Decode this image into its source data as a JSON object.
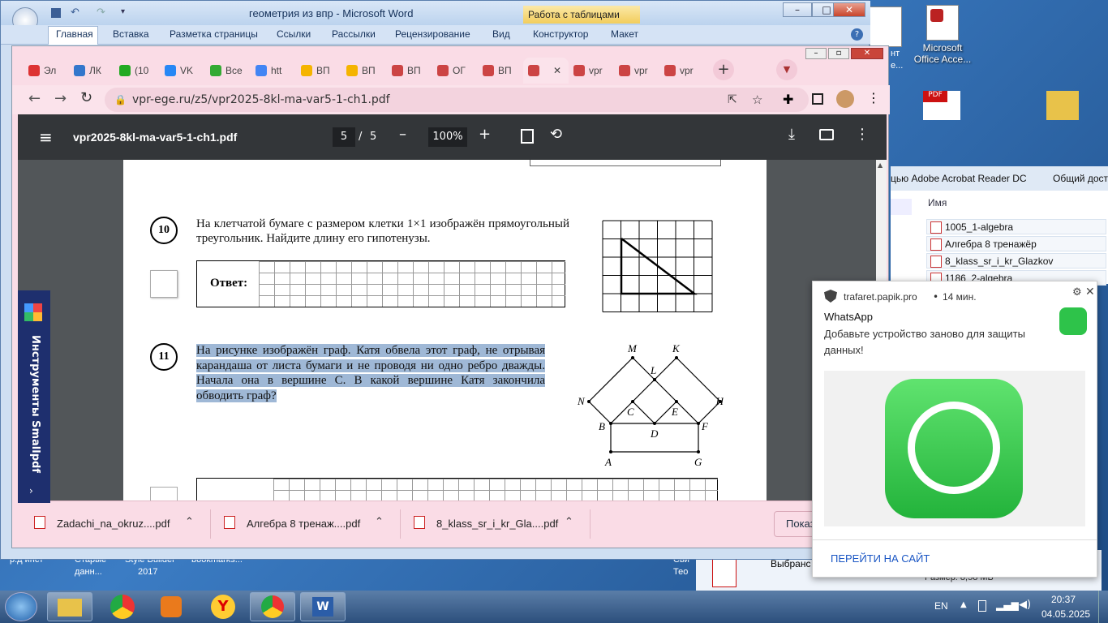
{
  "word": {
    "title": "геометрия из впр - Microsoft Word",
    "table_tools": "Работа с таблицами",
    "tabs": [
      "Главная",
      "Вставка",
      "Разметка страницы",
      "Ссылки",
      "Рассылки",
      "Рецензирование",
      "Вид",
      "Конструктор",
      "Макет"
    ]
  },
  "desktop": {
    "icons": [
      {
        "label": "Microsoft Office Acce..."
      }
    ],
    "partial_texts": [
      "нт",
      "е...",
      "р.д инст",
      "Старые",
      "данн...",
      "Style Builder",
      "2017",
      "bookmarks...",
      "Сви",
      "Тео",
      "Выбранс"
    ]
  },
  "chrome": {
    "tabs": [
      {
        "label": "Эл",
        "color": "#d33"
      },
      {
        "label": "ЛК",
        "color": "#3377cc"
      },
      {
        "label": "(10",
        "color": "#2a2"
      },
      {
        "label": "VK",
        "color": "#2787f5"
      },
      {
        "label": "Все",
        "color": "#3a3"
      },
      {
        "label": "htt",
        "color": "#4285f4"
      },
      {
        "label": "ВП",
        "color": "#f5b400"
      },
      {
        "label": "ВП",
        "color": "#f5b400"
      },
      {
        "label": "ВП",
        "color": "#c44"
      },
      {
        "label": "ОГ",
        "color": "#c44"
      },
      {
        "label": "ВП",
        "color": "#c44"
      },
      {
        "label": "",
        "color": "#c44"
      },
      {
        "label": "vpr",
        "color": "#c44"
      },
      {
        "label": "vpr",
        "color": "#c44"
      },
      {
        "label": "vpr",
        "color": "#c44"
      }
    ],
    "active_tab_index": 11,
    "url": "vpr-ege.ru/z5/vpr2025-8kl-ma-var5-1-ch1.pdf"
  },
  "pdf": {
    "filename": "vpr2025-8kl-ma-var5-1-ch1.pdf",
    "page_current": "5",
    "page_sep": "/",
    "page_total": "5",
    "zoom": "100%"
  },
  "task10": {
    "num": "10",
    "text": "На клетчатой бумаге с размером клетки 1×1 изображён прямоугольный треугольник. Найдите длину его гипотенузы.",
    "answer_label": "Ответ:"
  },
  "task11": {
    "num": "11",
    "text": "На рисунке изображён граф. Катя обвела этот граф, не отрывая карандаша от листа бумаги и не проводя ни одно ребро дважды. Начала она в вершине C. В какой вершине Катя закончила обводить граф?",
    "vertices": {
      "M": "M",
      "K": "K",
      "L": "L",
      "N": "N",
      "H": "H",
      "C": "C",
      "E": "E",
      "B": "B",
      "D": "D",
      "F": "F",
      "A": "A",
      "G": "G"
    }
  },
  "downloads": [
    {
      "name": "Zadachi_na_okruz....pdf"
    },
    {
      "name": "Алгебра 8 тренаж....pdf"
    },
    {
      "name": "8_klass_sr_i_kr_Gla....pdf"
    }
  ],
  "downloads_show": "Показ",
  "smallpdf": {
    "label": "Инструменты Smallpdf"
  },
  "explorer": {
    "open_with": "цью Adobe Acrobat Reader DC",
    "share": "Общий дост",
    "col_name": "Имя",
    "files": [
      "1005_1-algebra",
      "Алгебра 8 тренажёр",
      "8_klass_sr_i_kr_Glazkov",
      "1186_2-algebra"
    ],
    "size_label": "Размер: 8,58 МБ"
  },
  "notification": {
    "site": "trafaret.papik.pro",
    "time": "14 мин.",
    "app": "WhatsApp",
    "message": "Добавьте устройство заново для защиты данных!",
    "action": "ПЕРЕЙТИ НА САЙТ",
    "dot": "•"
  },
  "taskbar": {
    "lang": "EN",
    "time": "20:37",
    "date": "04.05.2025"
  }
}
